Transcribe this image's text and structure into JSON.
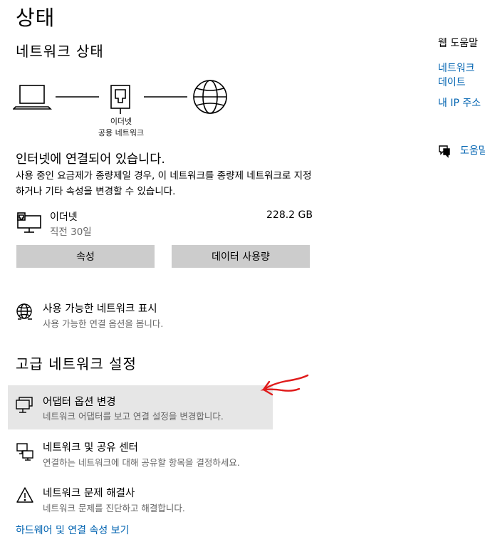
{
  "page": {
    "title": "상태"
  },
  "network_status": {
    "section_title": "네트워크 상태",
    "diagram_label_type": "이더넷",
    "diagram_label_network": "공용 네트워크",
    "headline": "인터넷에 연결되어 있습니다.",
    "description": "사용 중인 요금제가 종량제일 경우, 이 네트워크를 종량제 네트워크로 지정하거나 기타 속성을 변경할 수 있습니다."
  },
  "connection": {
    "name": "이더넷",
    "time": "직전 30일",
    "data_used": "228.2 GB",
    "properties_button": "속성",
    "data_usage_button": "데이터 사용량"
  },
  "available_networks": {
    "title": "사용 가능한 네트워크 표시",
    "subtitle": "사용 가능한 연결 옵션을 봅니다."
  },
  "advanced": {
    "section_title": "고급 네트워크 설정",
    "items": [
      {
        "title": "어댑터 옵션 변경",
        "subtitle": "네트워크 어댑터를 보고 연결 설정을 변경합니다."
      },
      {
        "title": "네트워크 및 공유 센터",
        "subtitle": "연결하는 네트워크에 대해 공유할 항목을 결정하세요."
      },
      {
        "title": "네트워크 문제 해결사",
        "subtitle": "네트워크 문제를 진단하고 해결합니다."
      }
    ],
    "partial_link": "하드웨어 및 연결 속성 보기"
  },
  "right_panel": {
    "help_title": "웹 도움말",
    "link1_line1": "네트워크",
    "link1_line2": "데이트",
    "link2": "내 IP 주소",
    "feedback_link": "도움말"
  },
  "colors": {
    "accent": "#0063b1",
    "button_bg": "#cccccc",
    "highlight_row": "#e6e6e6",
    "annotation_arrow": "#e01b1b"
  }
}
